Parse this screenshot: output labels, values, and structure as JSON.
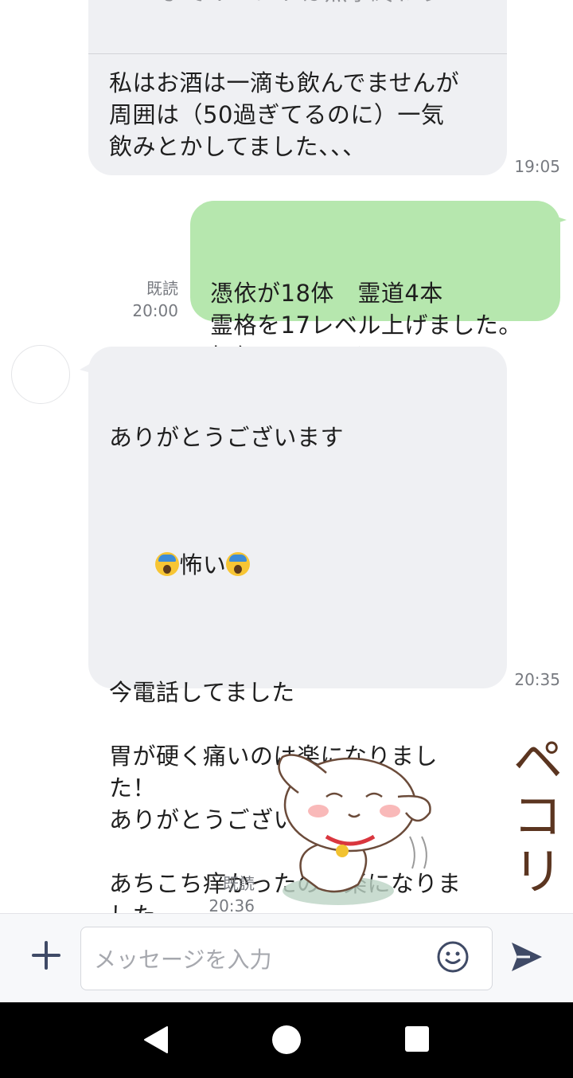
{
  "messages": {
    "reply_incoming": {
      "quoted_text": "までイベントは無事終わり…",
      "body": "私はお酒は一滴も飲んでませんが\n周囲は（50過ぎてるのに）一気\n飲みとかしてました、、、",
      "time": "19:05"
    },
    "outgoing_1": {
      "body": "憑依が18体　霊道4本\n霊格を17レベル上げました。\n如何でしょうか?",
      "read_label": "既読",
      "time": "20:00"
    },
    "incoming_2": {
      "line1": "ありがとうございます",
      "line2_text": "怖い",
      "line2_emoji": "face-screaming-in-fear-icon",
      "rest": "今電話してました\n\n胃が硬く痛いのは楽になりまし\nた！\nありがとうございます\n\nあちこち痒かったのも楽になりま\nした",
      "time": "20:35"
    },
    "outgoing_sticker": {
      "sticker_text": "ペコリ",
      "read_label": "既読",
      "time": "20:36"
    }
  },
  "input_bar": {
    "placeholder": "メッセージを入力",
    "plus_icon": "plus-icon",
    "emoji_icon": "smile-icon",
    "send_icon": "send-icon"
  },
  "nav_bar": {
    "back_icon": "back-triangle-icon",
    "home_icon": "home-circle-icon",
    "recent_icon": "recent-apps-square-icon"
  },
  "colors": {
    "incoming_bubble": "#eff0f3",
    "outgoing_bubble": "#b6e7ae",
    "meta_text": "#777a80",
    "icon_dark": "#3f4a66",
    "nav_bar": "#000000"
  }
}
